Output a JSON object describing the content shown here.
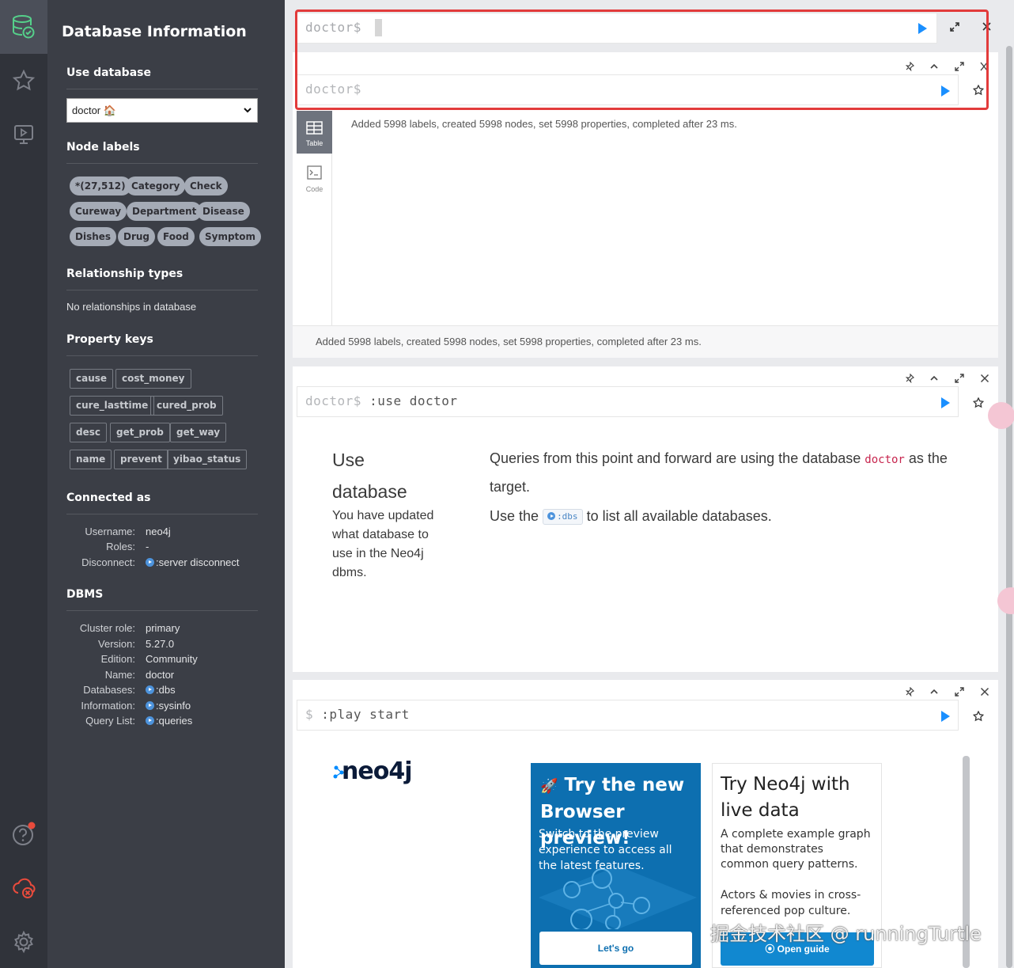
{
  "sidebar": {
    "title": "Database Information",
    "use_database": {
      "heading": "Use database",
      "selected": "doctor 🏠"
    },
    "node_labels": {
      "heading": "Node labels",
      "items": [
        "*(27,512)",
        "Category",
        "Check",
        "Cureway",
        "Department",
        "Disease",
        "Dishes",
        "Drug",
        "Food",
        "Symptom"
      ]
    },
    "relationship_types": {
      "heading": "Relationship types",
      "empty_text": "No relationships in database"
    },
    "property_keys": {
      "heading": "Property keys",
      "items": [
        "cause",
        "cost_money",
        "cure_lasttime",
        "cured_prob",
        "desc",
        "get_prob",
        "get_way",
        "name",
        "prevent",
        "yibao_status"
      ]
    },
    "connected_as": {
      "heading": "Connected as",
      "username_label": "Username:",
      "username": "neo4j",
      "roles_label": "Roles:",
      "roles": "-",
      "disconnect_label": "Disconnect:",
      "disconnect_link": ":server disconnect"
    },
    "dbms": {
      "heading": "DBMS",
      "cluster_role_label": "Cluster role:",
      "cluster_role": "primary",
      "version_label": "Version:",
      "version": "5.27.0",
      "edition_label": "Edition:",
      "edition": "Community",
      "name_label": "Name:",
      "name": "doctor",
      "databases_label": "Databases:",
      "databases_link": ":dbs",
      "information_label": "Information:",
      "information_link": ":sysinfo",
      "query_list_label": "Query List:",
      "query_list_link": ":queries"
    }
  },
  "editor": {
    "prompt": "doctor$"
  },
  "frame1": {
    "prompt": "doctor$",
    "result": "Added 5998 labels, created 5998 nodes, set 5998 properties, completed after 23 ms.",
    "footer": "Added 5998 labels, created 5998 nodes, set 5998 properties, completed after 23 ms.",
    "tab_table": "Table",
    "tab_code": "Code"
  },
  "frame2": {
    "prompt": "doctor$",
    "command": ":use doctor",
    "heading_line1": "Use",
    "heading_line2": "database",
    "description": "You have updated what database to use in the Neo4j dbms.",
    "line1_pre": "Queries from this point and forward are using the database",
    "db_name": "doctor",
    "line1_post": "as the",
    "line1_end": "target.",
    "line2_pre": "Use the",
    "dbs_chip": ":dbs",
    "line2_post": "to list all available databases."
  },
  "frame3": {
    "prompt": "$",
    "command": ":play start",
    "logo": "neo4j",
    "card1": {
      "title": "Try the new Browser preview!",
      "body": "Switch to the preview experience to access all the latest features.",
      "button": "Let's go"
    },
    "card2": {
      "title": "Try Neo4j with live data",
      "body": "A complete example graph that demonstrates common query patterns.",
      "body2": "Actors & movies in cross-referenced pop culture.",
      "button": "Open guide"
    }
  },
  "watermark": "掘金技术社区 @ runningTurtle",
  "colors": {
    "accent": "#1a8fff",
    "highlight": "#e23b3b",
    "sidebar_bg": "#3b3e46",
    "iconbar_bg": "#30333a"
  }
}
